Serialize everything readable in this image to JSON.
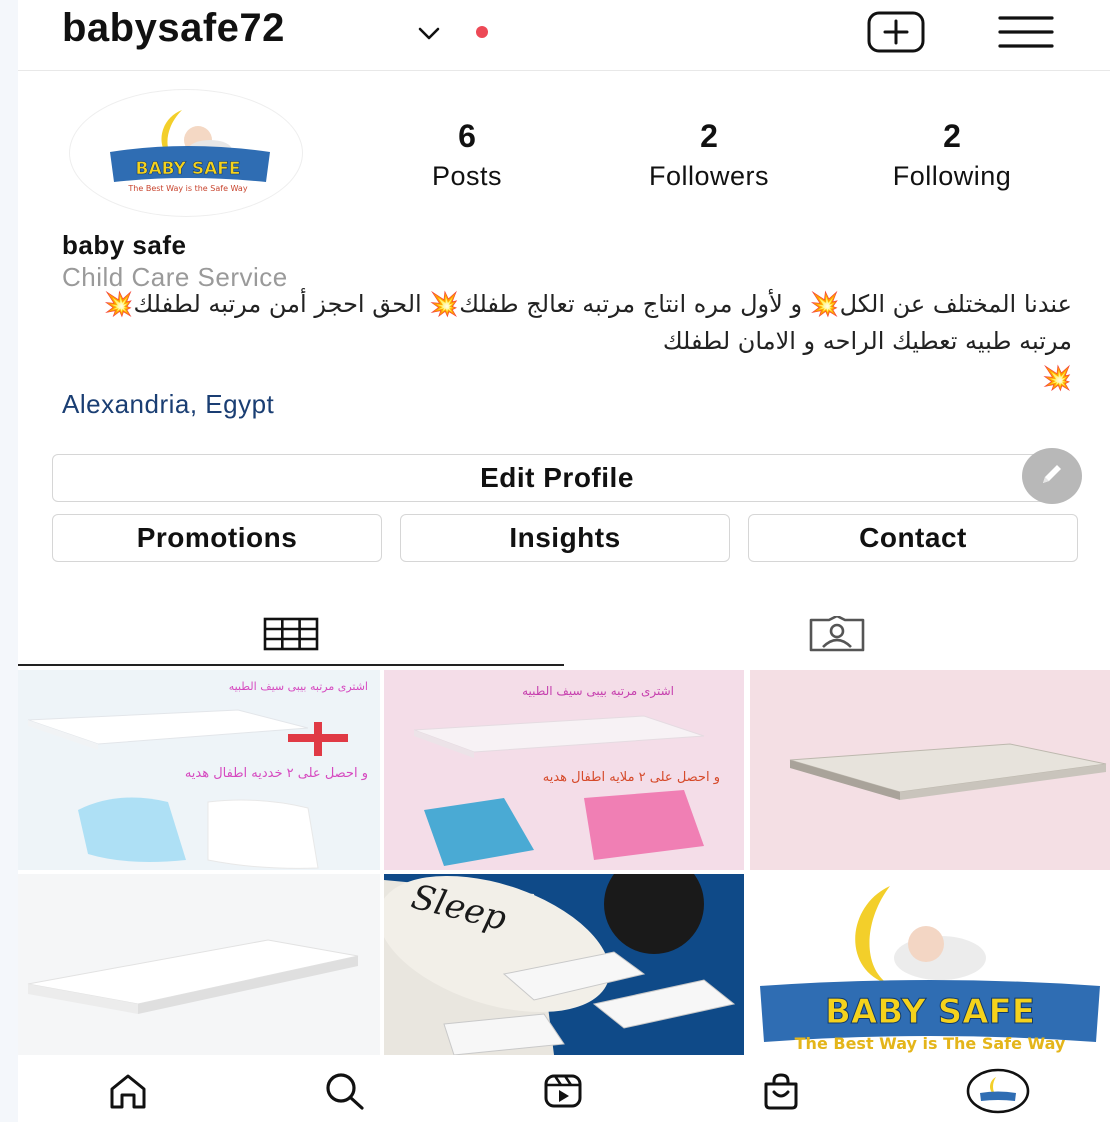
{
  "header": {
    "username": "babysafe72"
  },
  "profile": {
    "avatar_brand": "BABY SAFE",
    "avatar_tagline": "The Best Way is the Safe Way",
    "stats": [
      {
        "value": "6",
        "label": "Posts"
      },
      {
        "value": "2",
        "label": "Followers"
      },
      {
        "value": "2",
        "label": "Following"
      }
    ],
    "name": "baby safe",
    "category": "Child Care Service",
    "bio": {
      "p1": "عندنا المختلف عن الكل",
      "p2": "و لأول مره انتاج مرتبه تعالج طفلك",
      "p3": "الحق احجز أمن مرتبه لطفلك",
      "p4": "مرتبه طبيه تعطيك الراحه و الامان لطفلك",
      "burst": "💥"
    },
    "location": "Alexandria, Egypt"
  },
  "buttons": {
    "edit_profile": "Edit Profile",
    "promotions": "Promotions",
    "insights": "Insights",
    "contact": "Contact"
  },
  "posts": [
    {
      "top_text": "اشترى مرتبه بيبى سيف الطبيه",
      "bottom_text": "و احصل على ٢ خدديه اطفال هديه"
    },
    {
      "top_text": "اشترى مرتبه بيبى سيف الطبيه",
      "bottom_text": "و احصل على ٢ ملايه اطفال هديه"
    },
    {
      "top_text": "",
      "bottom_text": ""
    },
    {
      "top_text": "",
      "bottom_text": ""
    },
    {
      "top_text": "Sleep",
      "bottom_text": ""
    },
    {
      "top_text": "BABY SAFE",
      "bottom_text": "The Best Way is The Safe Way"
    }
  ],
  "colors": {
    "accent_link": "#1a3e73",
    "notification_dot": "#ed4956",
    "promo_plus": "#e03a45"
  },
  "icons": {
    "header": [
      "chevron-down-icon",
      "new-post-icon",
      "menu-icon"
    ],
    "tabs": [
      "grid-icon",
      "tagged-icon"
    ],
    "nav": [
      "home-icon",
      "search-icon",
      "reels-icon",
      "shop-icon",
      "profile-avatar-icon"
    ]
  }
}
